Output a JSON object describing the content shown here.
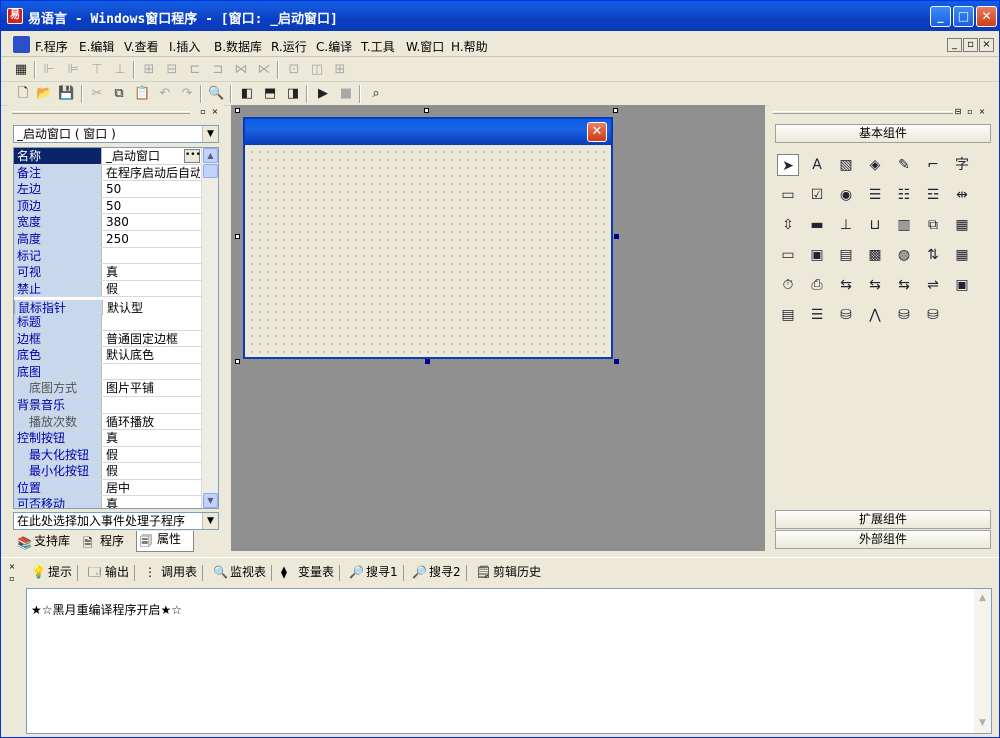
{
  "window": {
    "title": "易语言 - Windows窗口程序 - [窗口: _启动窗口]",
    "icon_text": "易",
    "minimize": "_",
    "restore": "□",
    "close": "✕"
  },
  "menu": {
    "items": [
      "F.程序",
      "E.编辑",
      "V.查看",
      "I.插入",
      "B.数据库",
      "R.运行",
      "C.编译",
      "T.工具",
      "W.窗口",
      "H.帮助"
    ],
    "mdi_min": "_",
    "mdi_restore": "▫",
    "mdi_close": "×"
  },
  "left_panel": {
    "object_combo": "_启动窗口 ( 窗口 )",
    "event_combo": "在此处选择加入事件处理子程序",
    "properties": [
      {
        "name": "名称",
        "value": "_启动窗口"
      },
      {
        "name": "备注",
        "value": "在程序启动后自动"
      },
      {
        "name": "左边",
        "value": "50"
      },
      {
        "name": "顶边",
        "value": "50"
      },
      {
        "name": "宽度",
        "value": "380"
      },
      {
        "name": "高度",
        "value": "250"
      },
      {
        "name": "标记",
        "value": ""
      },
      {
        "name": "可视",
        "value": "真"
      },
      {
        "name": "禁止",
        "value": "假"
      },
      {
        "name": "鼠标指针",
        "value": "默认型"
      },
      {
        "name": "标题",
        "value": ""
      },
      {
        "name": "边框",
        "value": "普通固定边框"
      },
      {
        "name": "底色",
        "value": "默认底色"
      },
      {
        "name": "底图",
        "value": ""
      },
      {
        "name": "底图方式",
        "value": "图片平铺"
      },
      {
        "name": "背景音乐",
        "value": ""
      },
      {
        "name": "播放次数",
        "value": "循环播放"
      },
      {
        "name": "控制按钮",
        "value": "真"
      },
      {
        "name": "最大化按钮",
        "value": "假"
      },
      {
        "name": "最小化按钮",
        "value": "假"
      },
      {
        "name": "位置",
        "value": "居中"
      },
      {
        "name": "可否移动",
        "value": "真"
      }
    ],
    "tabs": [
      "支持库",
      "程序",
      "属性"
    ]
  },
  "right_panel": {
    "basic": "基本组件",
    "extended": "扩展组件",
    "external": "外部组件"
  },
  "bottom_panel": {
    "tabs": [
      "提示",
      "输出",
      "调用表",
      "监视表",
      "变量表",
      "搜寻1",
      "搜寻2",
      "剪辑历史"
    ],
    "output_text": "★☆黑月重编译程序开启★☆"
  }
}
